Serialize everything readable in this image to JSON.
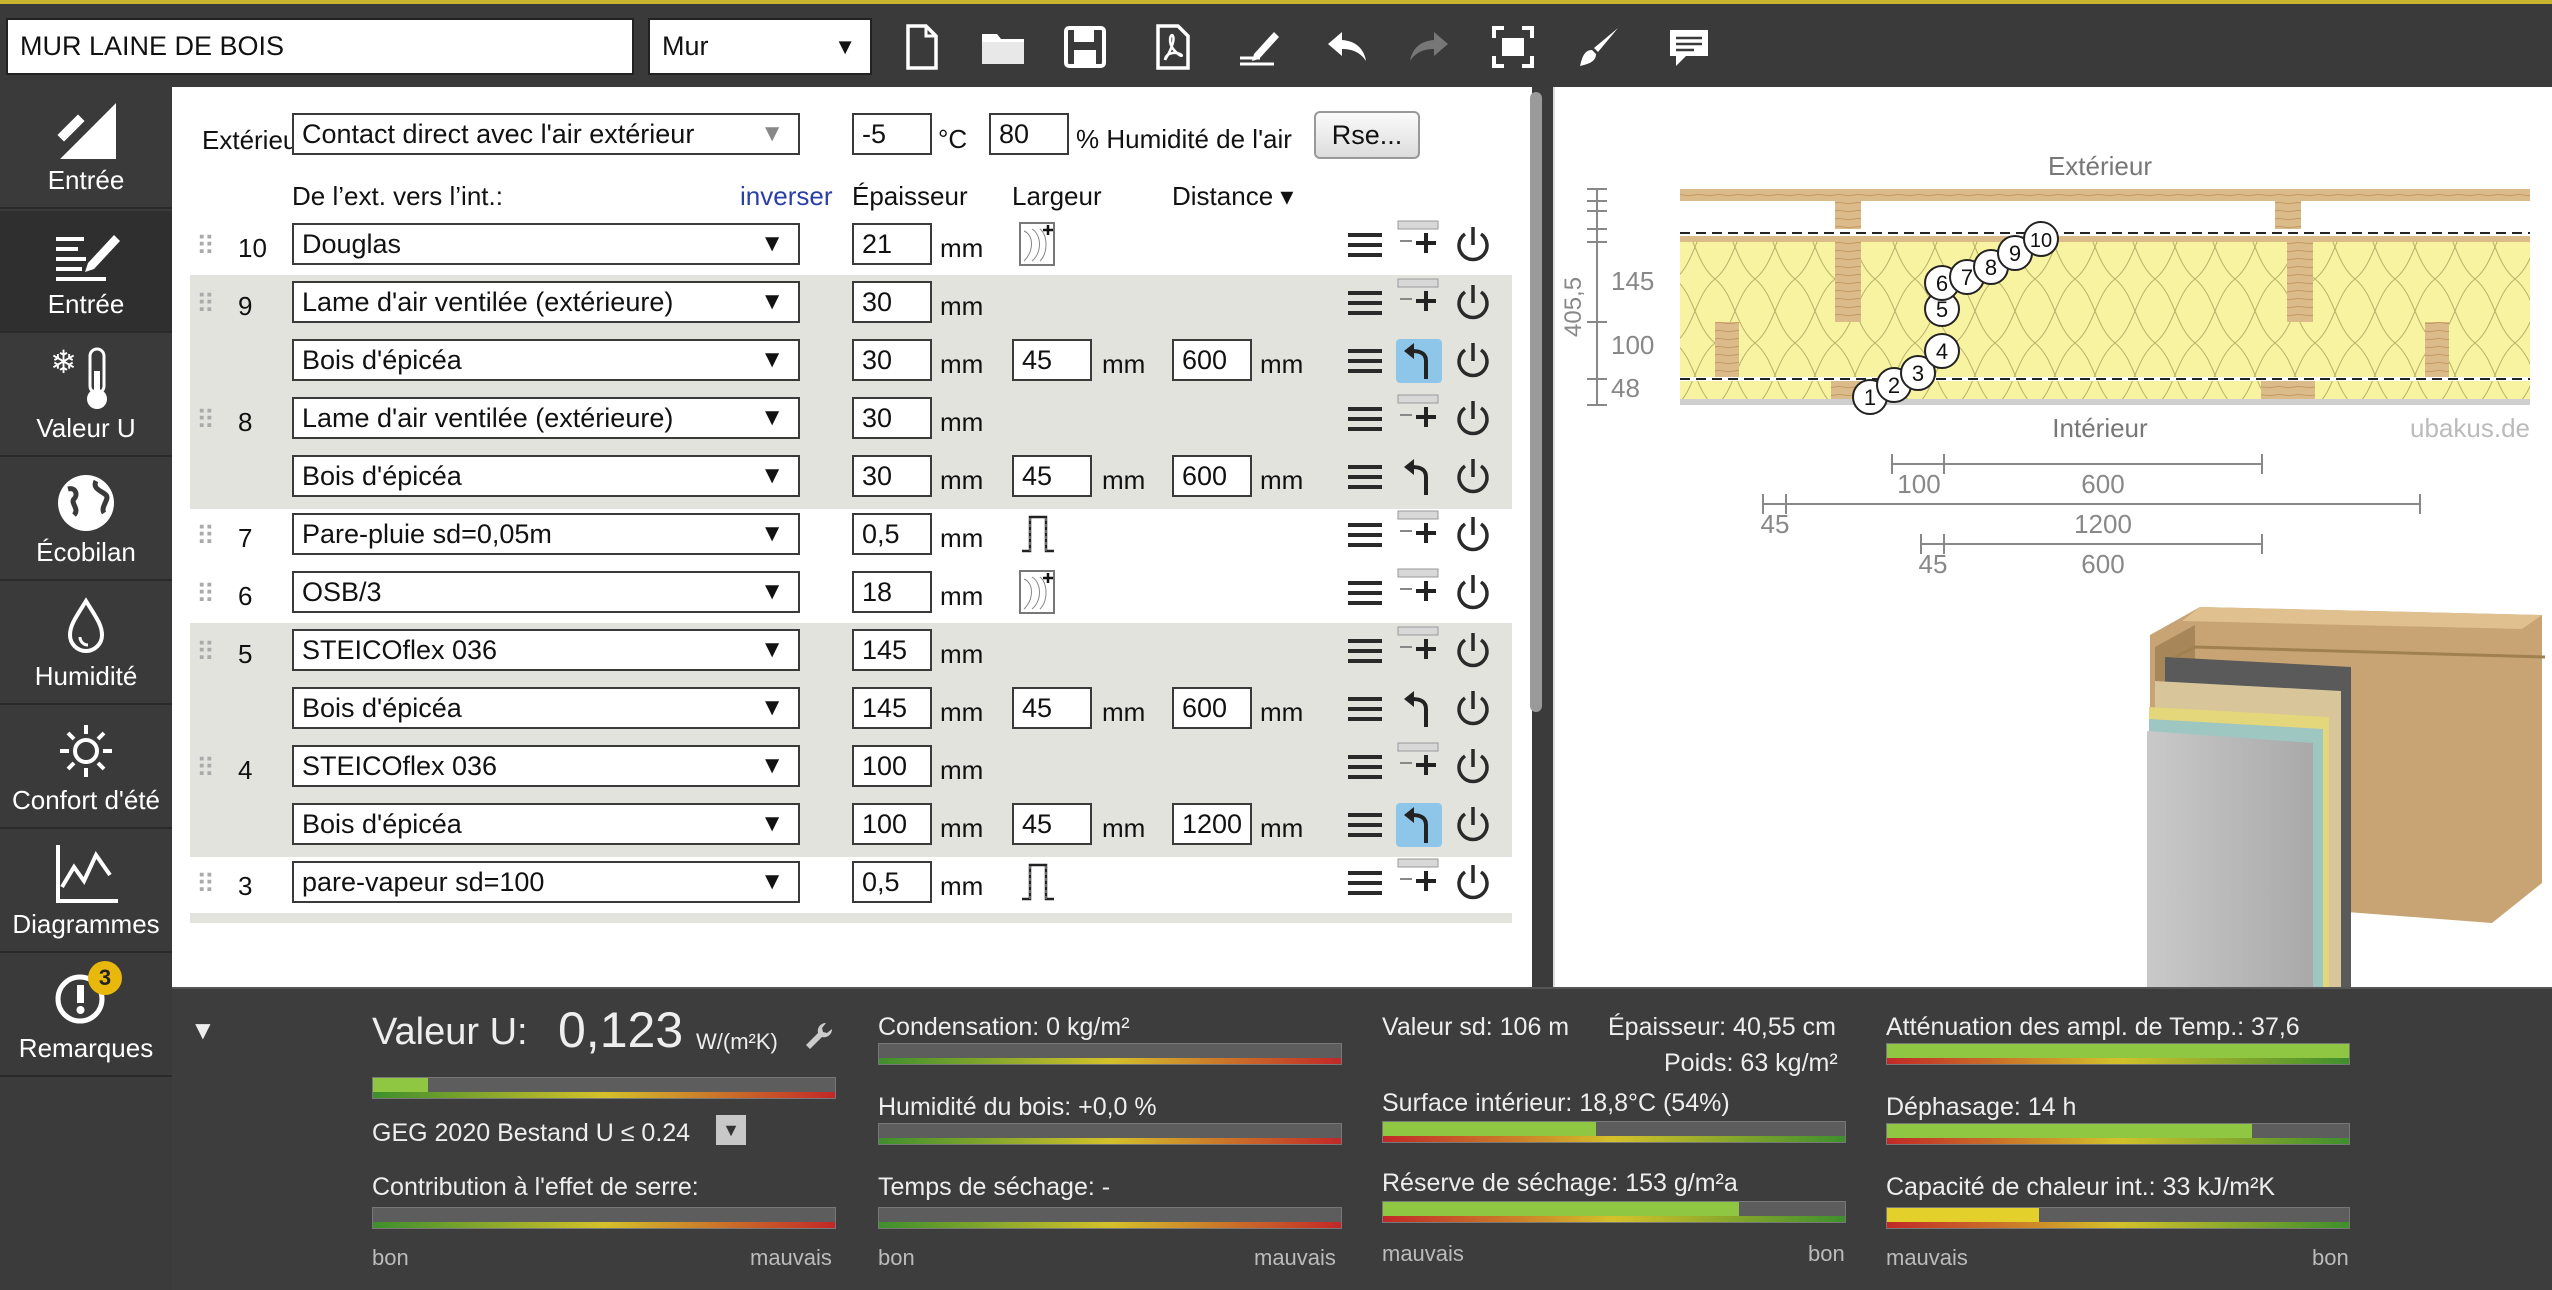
{
  "toolbar": {
    "project_name": "MUR LAINE DE BOIS",
    "construction_type": "Mur"
  },
  "sidebar": {
    "items": [
      {
        "label": "Entrée",
        "icon": "ruler-triangle-icon"
      },
      {
        "label": "Entrée",
        "icon": "edit-list-icon"
      },
      {
        "label": "Valeur U",
        "icon": "snow-thermometer-icon"
      },
      {
        "label": "Écobilan",
        "icon": "globe-icon"
      },
      {
        "label": "Humidité",
        "icon": "water-drop-icon"
      },
      {
        "label": "Confort d'été",
        "icon": "sun-icon"
      },
      {
        "label": "Diagrammes",
        "icon": "chart-icon"
      },
      {
        "label": "Remarques",
        "icon": "alert-icon",
        "badge": "3"
      }
    ]
  },
  "boundary": {
    "label": "Extérieur",
    "condition": "Contact direct avec l'air extérieur",
    "temperature": "-5",
    "temp_unit": "°C",
    "humidity": "80",
    "humidity_label": "% Humidité de l'air",
    "rse_button": "Rse..."
  },
  "columns": {
    "direction": "De l’ext. vers l’int.:",
    "invert": "inverser",
    "thickness": "Épaisseur",
    "width": "Largeur",
    "distance": "Distance ▾"
  },
  "units": {
    "mm": "mm"
  },
  "layers": [
    {
      "num": "10",
      "material": "Douglas",
      "thickness": "21"
    },
    {
      "num": "9",
      "material": "Lame d'air ventilée (extérieure)",
      "thickness": "30",
      "sub": {
        "material": "Bois d'épicéa",
        "thickness": "30",
        "width": "45",
        "distance": "600"
      }
    },
    {
      "num": "8",
      "material": "Lame d'air ventilée (extérieure)",
      "thickness": "30",
      "sub": {
        "material": "Bois d'épicéa",
        "thickness": "30",
        "width": "45",
        "distance": "600"
      }
    },
    {
      "num": "7",
      "material": "Pare-pluie sd=0,05m",
      "thickness": "0,5"
    },
    {
      "num": "6",
      "material": "OSB/3",
      "thickness": "18"
    },
    {
      "num": "5",
      "material": "STEICOflex 036",
      "thickness": "145",
      "sub": {
        "material": "Bois d'épicéa",
        "thickness": "145",
        "width": "45",
        "distance": "600"
      }
    },
    {
      "num": "4",
      "material": "STEICOflex 036",
      "thickness": "100",
      "sub": {
        "material": "Bois d'épicéa",
        "thickness": "100",
        "width": "45",
        "distance": "1200"
      }
    },
    {
      "num": "3",
      "material": "pare-vapeur sd=100",
      "thickness": "0,5"
    }
  ],
  "diagram": {
    "exterior": "Extérieur",
    "interior": "Intérieur",
    "watermark": "ubakus.de",
    "total": "405,5",
    "dims_vertical": [
      "145",
      "100",
      "48"
    ],
    "layer_markers": [
      "1",
      "2",
      "3",
      "4",
      "5",
      "6",
      "7",
      "8",
      "9",
      "10"
    ],
    "dim_row1": [
      "100",
      "600"
    ],
    "dim_row2": [
      "45",
      "1200"
    ],
    "dim_row3": [
      "45",
      "600"
    ]
  },
  "results": {
    "u_label": "Valeur U:",
    "u_value": "0,123",
    "u_unit": "W/(m²K)",
    "u_fill": 0.12,
    "standard": "GEG 2020 Bestand U ≤ 0.24",
    "greenhouse": "Contribution à l'effet de serre:",
    "condensation": "Condensation: 0 kg/m²",
    "wood_moisture": "Humidité du bois: +0,0 %",
    "drying_time": "Temps de séchage: -",
    "sd_value": "Valeur sd: 106 m",
    "thickness": "Épaisseur: 40,55 cm",
    "weight": "Poids: 63 kg/m²",
    "surface_temp": "Surface intérieur: 18,8°C (54%)",
    "surface_fill": 0.46,
    "drying_reserve": "Réserve de séchage: 153 g/m²a",
    "drying_fill": 0.77,
    "attenuation": "Atténuation des ampl. de Temp.: 37,6",
    "attenuation_fill": 1.0,
    "phase_shift": "Déphasage: 14 h",
    "phase_fill": 0.79,
    "heat_capacity": "Capacité de chaleur int.: 33 kJ/m²K",
    "heat_fill": 0.33,
    "good": "bon",
    "bad": "mauvais"
  },
  "colors": {
    "accent": "#c9b42e",
    "selected_button": "#8ec6ea",
    "insulation": "#f7f4a0",
    "wood": "#d9b98a"
  }
}
